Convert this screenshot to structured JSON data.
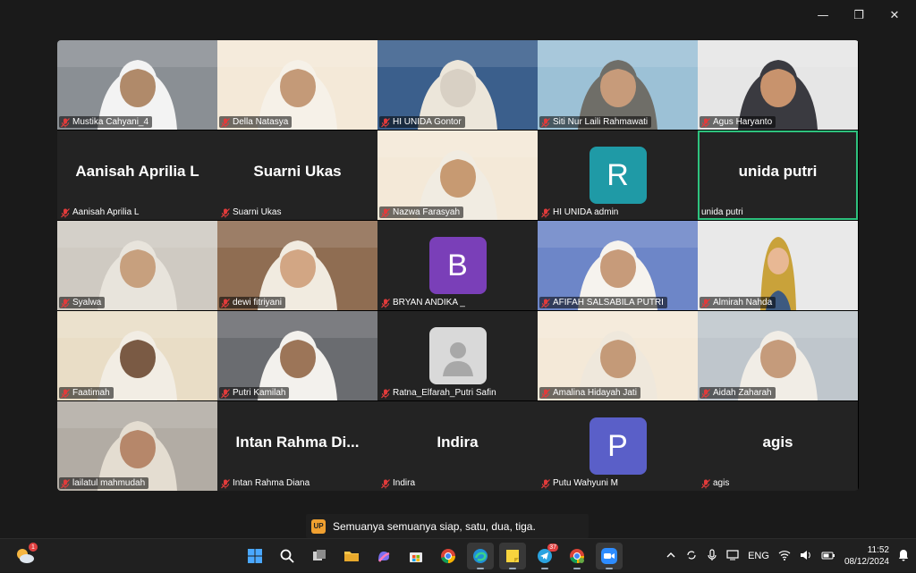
{
  "window": {
    "controls": {
      "minimize": "—",
      "maximize": "❐",
      "close": "✕"
    }
  },
  "participants": [
    {
      "name": "Mustika Cahyani_4",
      "type": "video",
      "bg": "#8a8f94",
      "face": "#b08a6a",
      "hijab": "#f3f3f3"
    },
    {
      "name": "Della Natasya",
      "type": "video",
      "bg": "#f4e9d8",
      "face": "#c49a78",
      "hijab": "#f6f1e8"
    },
    {
      "name": "HI UNIDA Gontor",
      "type": "video",
      "bg": "#3b5f8c",
      "face": "#d8d0c4",
      "hijab": "#ece6da"
    },
    {
      "name": "Siti Nur Laili Rahmawati",
      "type": "video",
      "bg": "#9cc1d6",
      "face": "#c79b7a",
      "hijab": "#6f6e68"
    },
    {
      "name": "Agus Haryanto",
      "type": "video",
      "bg": "#e6e6e6",
      "face": "#c8936d",
      "hijab": "#3a3a40"
    },
    {
      "name": "Aanisah Aprilia L",
      "type": "name",
      "display": "Aanisah Aprilia L"
    },
    {
      "name": "Suarni Ukas",
      "type": "name",
      "display": "Suarni Ukas"
    },
    {
      "name": "Nazwa Farasyah",
      "type": "video",
      "bg": "#f4e9d8",
      "face": "#c79a72",
      "hijab": "#f1ece2"
    },
    {
      "name": "HI UNIDA admin",
      "type": "avatar",
      "letter": "R",
      "color": "#1f9aa6"
    },
    {
      "name": "unida putri",
      "type": "name",
      "display": "unida putri",
      "active": true
    },
    {
      "name": "Syalwa",
      "type": "video",
      "bg": "#cfcac2",
      "face": "#c7a07e",
      "hijab": "#e8e4dc"
    },
    {
      "name": "dewi fitriyani",
      "type": "video",
      "bg": "#8f6d52",
      "face": "#d2a684",
      "hijab": "#f1ebe0"
    },
    {
      "name": "BRYAN ANDIKA _",
      "type": "avatar",
      "letter": "B",
      "color": "#7a3fb8"
    },
    {
      "name": "AFIFAH SALSABILA PUTRI",
      "type": "video",
      "bg": "#6d86c8",
      "face": "#c79b7a",
      "hijab": "#f6f3ee"
    },
    {
      "name": "Almirah Nahda",
      "type": "avatar3d",
      "bg": "#e9e9e9"
    },
    {
      "name": "Faatimah",
      "type": "video",
      "bg": "#e9ddc6",
      "face": "#7a5a44",
      "hijab": "#f2ede4"
    },
    {
      "name": "Putri Kamilah",
      "type": "video",
      "bg": "#6a6c70",
      "face": "#9c7558",
      "hijab": "#f3f1ed"
    },
    {
      "name": "Ratna_Elfarah_Putri Safin",
      "type": "placeholder"
    },
    {
      "name": "Amalina Hidayah Jati",
      "type": "video",
      "bg": "#f4e9d8",
      "face": "#c49a78",
      "hijab": "#efe8dc"
    },
    {
      "name": "Aidah Zaharah",
      "type": "video",
      "bg": "#bfc6cc",
      "face": "#c59b7b",
      "hijab": "#f1ede6"
    },
    {
      "name": "lailatul mahmudah",
      "type": "video",
      "bg": "#b2aca4",
      "face": "#b6876a",
      "hijab": "#e4ddd1"
    },
    {
      "name": "Intan Rahma Diana",
      "type": "name",
      "display": "Intan Rahma Di..."
    },
    {
      "name": "Indira",
      "type": "name",
      "display": "Indira"
    },
    {
      "name": "Putu Wahyuni M",
      "type": "avatar",
      "letter": "P",
      "color": "#5a5fc8"
    },
    {
      "name": "agis",
      "type": "name",
      "display": "agis"
    }
  ],
  "caption": {
    "speaker_initials": "UP",
    "text": "Semuanya semuanya siap, satu, dua, tiga."
  },
  "taskbar": {
    "weather_badge": "1",
    "apps": [
      "start-icon",
      "search-icon",
      "task-view-icon",
      "file-explorer-icon",
      "copilot-icon",
      "store-icon",
      "chrome-icon",
      "edge-icon",
      "sticky-notes-icon",
      "telegram-icon",
      "chrome-profile-icon",
      "zoom-icon"
    ],
    "telegram_badge": "37",
    "tray": {
      "language": "ENG",
      "time": "11:52",
      "date": "08/12/2024"
    }
  }
}
